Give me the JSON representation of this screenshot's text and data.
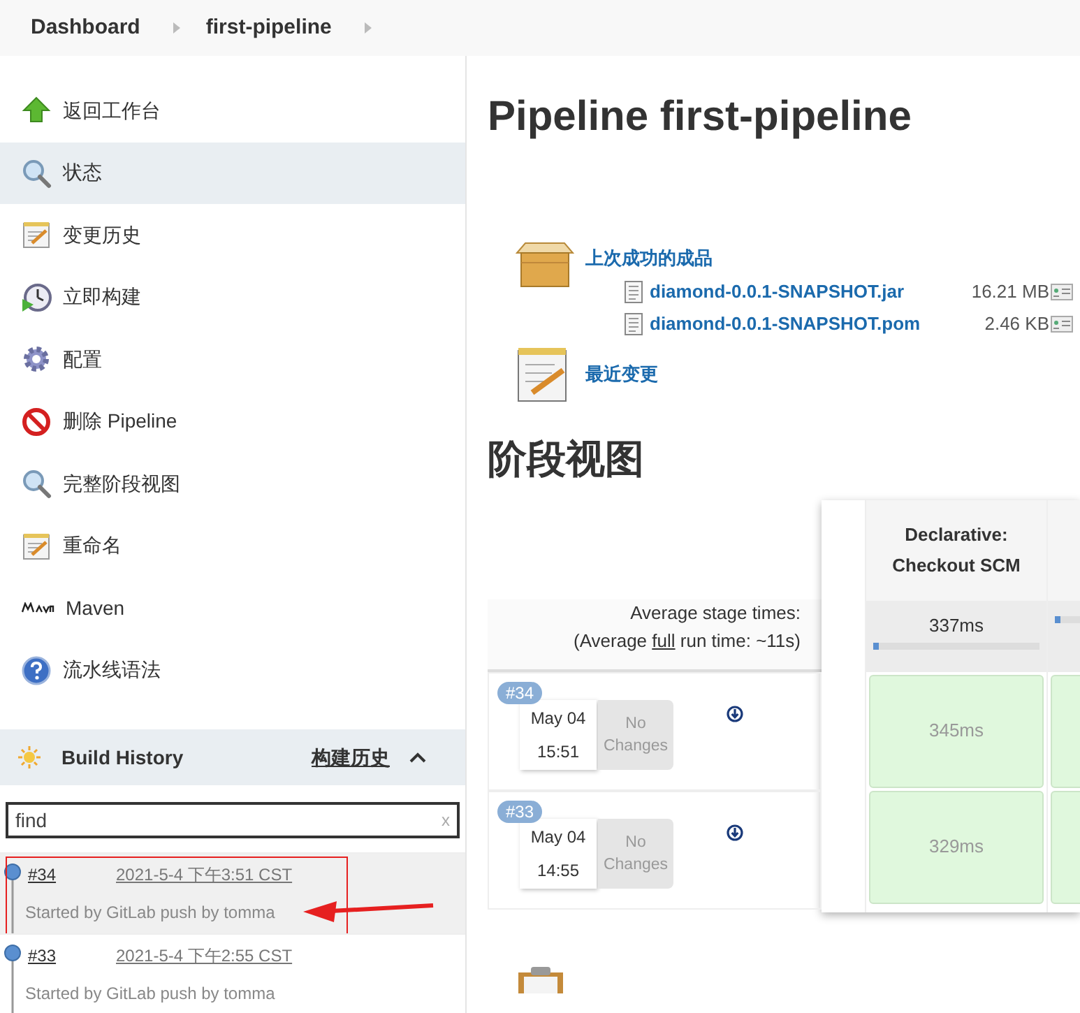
{
  "breadcrumbs": [
    "Dashboard",
    "first-pipeline"
  ],
  "sidebar": {
    "items": [
      {
        "label": "返回工作台",
        "kind": "up",
        "selected": false
      },
      {
        "label": "状态",
        "kind": "search",
        "selected": true
      },
      {
        "label": "变更历史",
        "kind": "notepad",
        "selected": false
      },
      {
        "label": "立即构建",
        "kind": "clock",
        "selected": false
      },
      {
        "label": "配置",
        "kind": "gear",
        "selected": false
      },
      {
        "label": "删除 Pipeline",
        "kind": "forbidden",
        "selected": false
      },
      {
        "label": "完整阶段视图",
        "kind": "search",
        "selected": false
      },
      {
        "label": "重命名",
        "kind": "notepad",
        "selected": false
      },
      {
        "label": "Maven",
        "kind": "maven",
        "selected": false
      },
      {
        "label": "流水线语法",
        "kind": "help",
        "selected": false
      }
    ]
  },
  "build_history": {
    "title": "Build History",
    "link": "构建历史",
    "expanded": true,
    "search": {
      "placeholder": "find",
      "clear": "x"
    },
    "builds": [
      {
        "number": "#34",
        "date": "2021-5-4 下午3:51 CST",
        "cause": "Started by GitLab push by tomma",
        "selected": true,
        "annotated": true
      },
      {
        "number": "#33",
        "date": "2021-5-4 下午2:55 CST",
        "cause": "Started by GitLab push by tomma",
        "selected": false,
        "annotated": false
      }
    ]
  },
  "main": {
    "title": "Pipeline first-pipeline",
    "artifacts": {
      "heading": "上次成功的成品",
      "files": [
        {
          "name": "diamond-0.0.1-SNAPSHOT.jar",
          "size": "16.21 MB"
        },
        {
          "name": "diamond-0.0.1-SNAPSHOT.pom",
          "size": "2.46 KB"
        }
      ]
    },
    "recent_changes": "最近变更",
    "stage_view": {
      "title": "阶段视图",
      "avg_label": "Average stage times:",
      "run_time": {
        "before": "(Average ",
        "link": "full",
        "after": " run time: ~11s)"
      },
      "stages": [
        {
          "name": "Declarative: Checkout SCM",
          "average": "337ms",
          "level": 0.03
        }
      ],
      "runs": [
        {
          "badge": "#34",
          "date": "May 04",
          "time": "15:51",
          "changes": "No Changes",
          "durations": [
            "345ms"
          ]
        },
        {
          "badge": "#33",
          "date": "May 04",
          "time": "14:55",
          "changes": "No Changes",
          "durations": [
            "329ms"
          ]
        }
      ]
    }
  }
}
